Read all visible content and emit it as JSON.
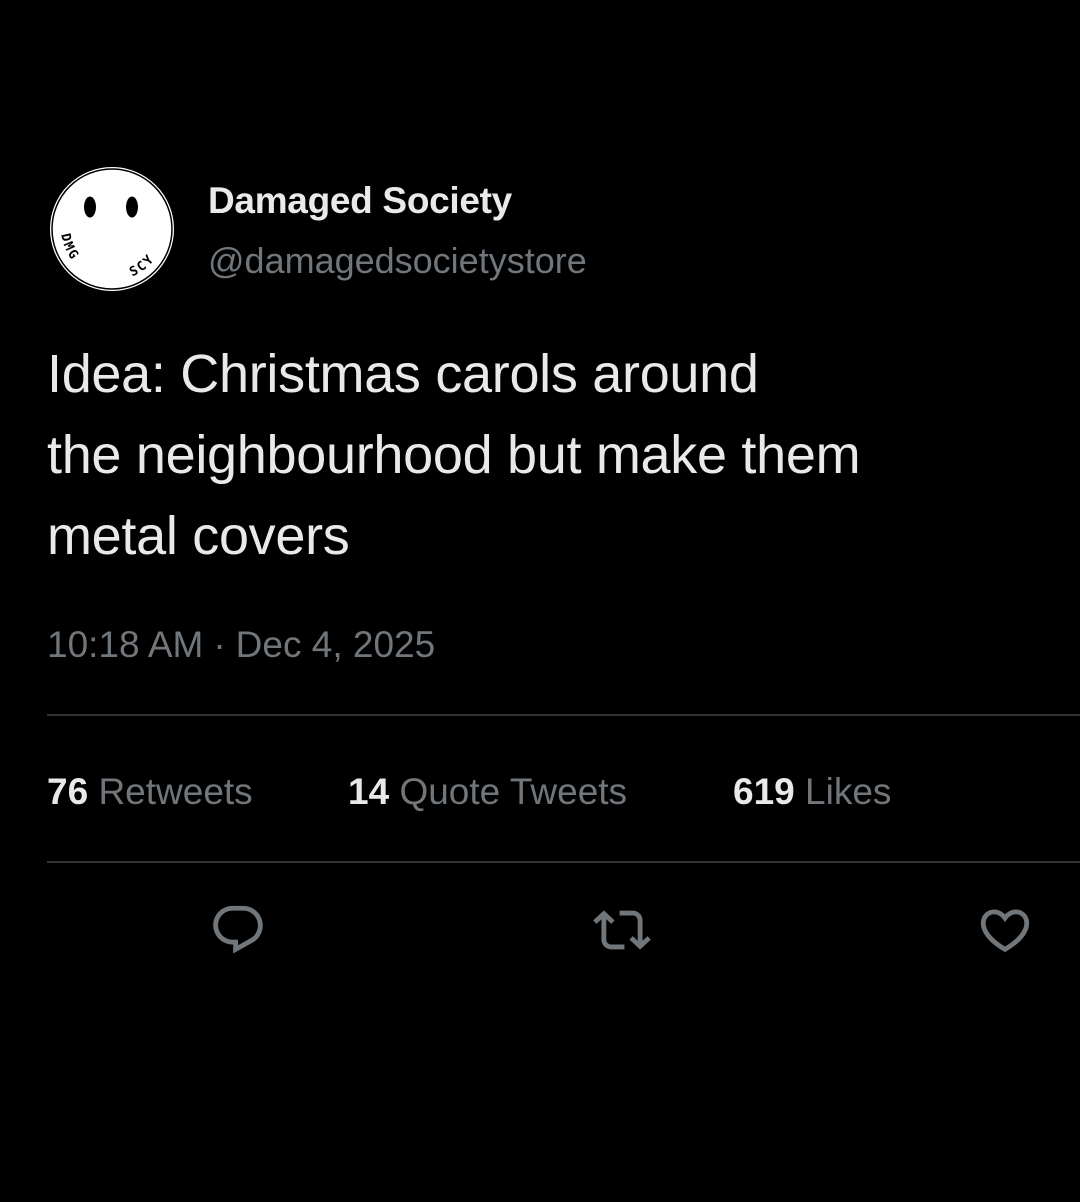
{
  "author": {
    "display_name": "Damaged Society",
    "handle": "@damagedsocietystore",
    "avatar": {
      "icon": "smiley-logo-icon",
      "logo_text_left": "DMG",
      "logo_text_right": "SCY",
      "background": "#ffffff",
      "ink": "#000000"
    }
  },
  "tweet": {
    "text_lines": [
      "Idea: Christmas carols around",
      "the neighbourhood but make them",
      "metal covers"
    ],
    "time": "10:18 AM",
    "separator": "·",
    "date": "Dec 4, 2025"
  },
  "stats": {
    "retweets": {
      "count": "76",
      "label": "Retweets"
    },
    "quote_tweets": {
      "count": "14",
      "label": "Quote Tweets"
    },
    "likes": {
      "count": "619",
      "label": "Likes"
    }
  },
  "actions": [
    {
      "name": "reply",
      "icon": "reply-icon"
    },
    {
      "name": "retweet",
      "icon": "retweet-icon"
    },
    {
      "name": "like",
      "icon": "heart-icon"
    }
  ],
  "colors": {
    "background": "#000000",
    "primary_text": "#e7e9ea",
    "secondary_text": "#71767b",
    "divider": "#2f3336"
  }
}
